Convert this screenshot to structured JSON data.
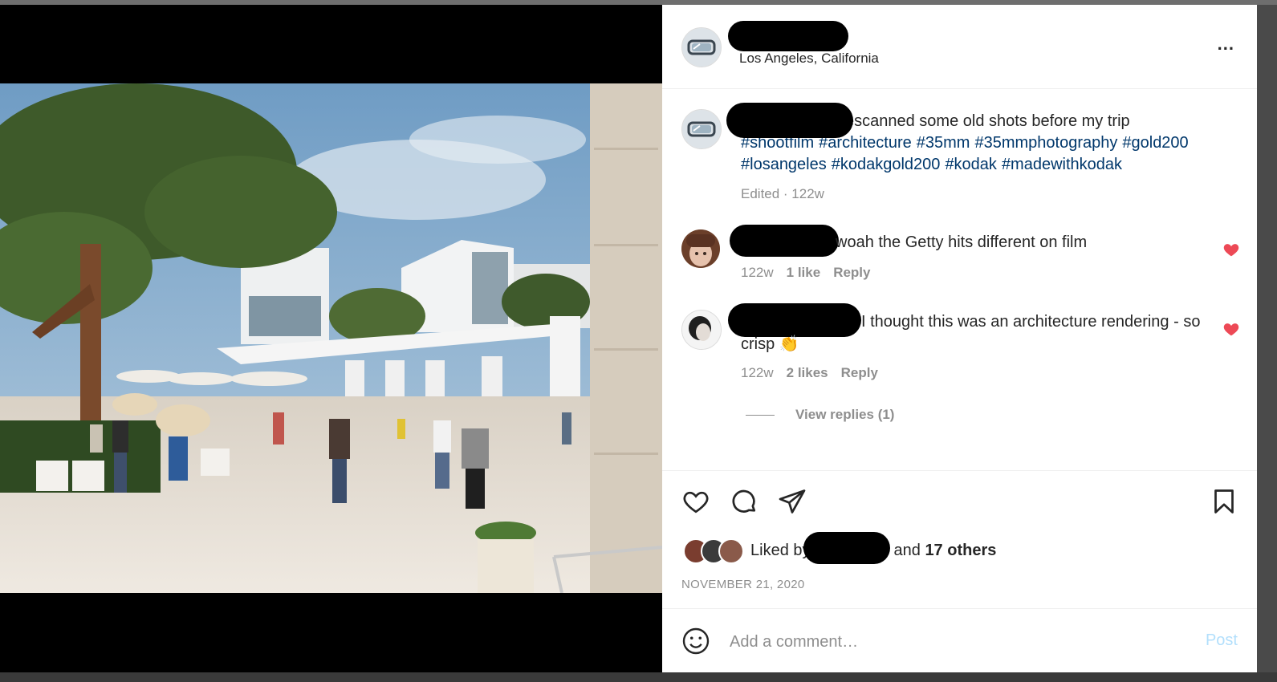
{
  "header": {
    "location": "Los Angeles, California",
    "more_label": "..."
  },
  "caption": {
    "text": "escanned some old shots before my trip",
    "hashtags": [
      "#shootfilm",
      "#architecture",
      "#35mm",
      "#35mmphotography",
      "#gold200",
      "#losangeles",
      "#kodakgold200",
      "#kodak",
      "#madewithkodak"
    ],
    "meta": "Edited · 122w"
  },
  "comments": [
    {
      "text": "woah the Getty hits different on film",
      "age": "122w",
      "likes": "1 like",
      "reply_label": "Reply",
      "liked": true
    },
    {
      "text": "I thought this was an architecture rendering - so crisp 👏",
      "age": "122w",
      "likes": "2 likes",
      "reply_label": "Reply",
      "liked": true
    }
  ],
  "view_replies": "View replies (1)",
  "likes": {
    "prefix": "Liked by",
    "middle": "and",
    "others": "17 others"
  },
  "date": "NOVEMBER 21, 2020",
  "composer": {
    "placeholder": "Add a comment…",
    "post_label": "Post"
  },
  "colors": {
    "hashtag": "#00376b",
    "heart": "#ed4956",
    "muted": "#8e8e8e",
    "post_disabled": "#b2dffc"
  }
}
